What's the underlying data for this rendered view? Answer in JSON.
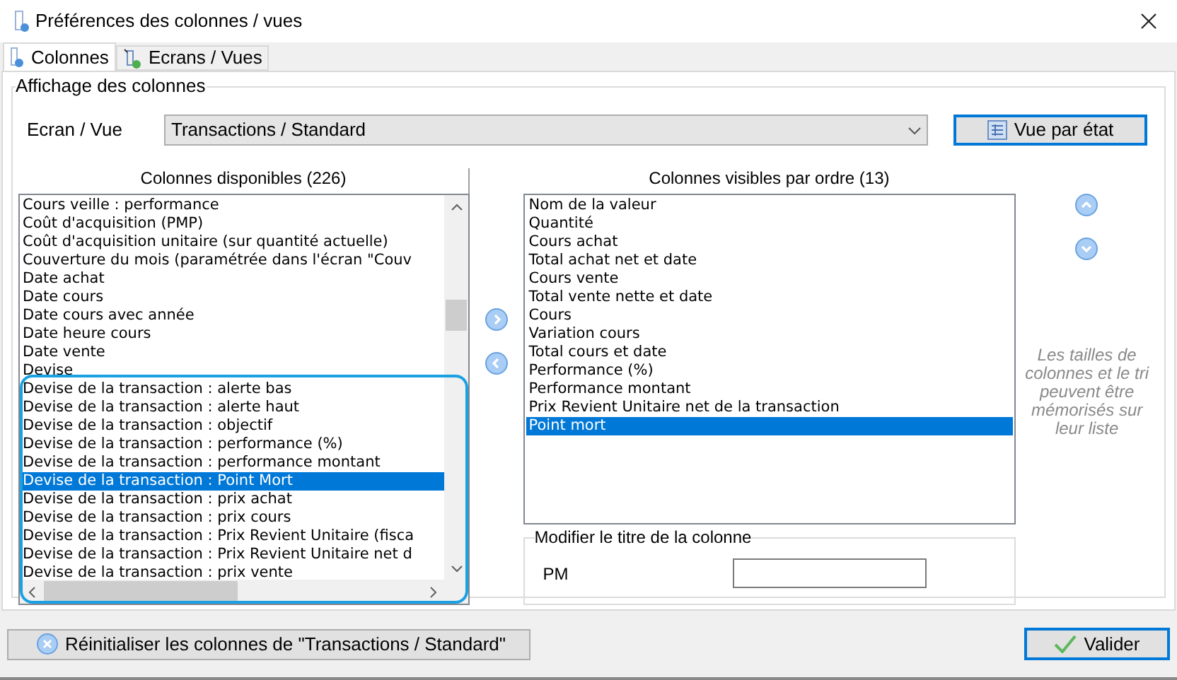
{
  "window": {
    "title": "Préférences des colonnes / vues"
  },
  "tabs": [
    {
      "label": "Colonnes",
      "selected": true
    },
    {
      "label": "Ecrans / Vues",
      "selected": false
    }
  ],
  "group_title": "Affichage des colonnes",
  "screen_view": {
    "label": "Ecran / Vue",
    "value": "Transactions / Standard"
  },
  "state_view_button": "Vue par état",
  "available": {
    "header": "Colonnes disponibles (226)",
    "items": [
      {
        "label": "Cours veille : performance",
        "selected": false
      },
      {
        "label": "Coût d'acquisition (PMP)",
        "selected": false
      },
      {
        "label": "Coût d'acquisition unitaire (sur quantité actuelle)",
        "selected": false
      },
      {
        "label": "Couverture du mois (paramétrée dans l'écran \"Couv",
        "selected": false
      },
      {
        "label": "Date achat",
        "selected": false
      },
      {
        "label": "Date cours",
        "selected": false
      },
      {
        "label": "Date cours avec année",
        "selected": false
      },
      {
        "label": "Date heure cours",
        "selected": false
      },
      {
        "label": "Date vente",
        "selected": false
      },
      {
        "label": "Devise",
        "selected": false
      },
      {
        "label": "Devise de la transaction : alerte bas",
        "selected": false
      },
      {
        "label": "Devise de la transaction : alerte haut",
        "selected": false
      },
      {
        "label": "Devise de la transaction : objectif",
        "selected": false
      },
      {
        "label": "Devise de la transaction : performance (%)",
        "selected": false
      },
      {
        "label": "Devise de la transaction : performance montant",
        "selected": false
      },
      {
        "label": "Devise de la transaction : Point Mort",
        "selected": true
      },
      {
        "label": "Devise de la transaction : prix achat",
        "selected": false
      },
      {
        "label": "Devise de la transaction : prix cours",
        "selected": false
      },
      {
        "label": "Devise de la transaction : Prix Revient Unitaire (fisca",
        "selected": false
      },
      {
        "label": "Devise de la transaction : Prix Revient Unitaire net d",
        "selected": false
      },
      {
        "label": "Devise de la transaction : prix vente",
        "selected": false
      }
    ]
  },
  "visible": {
    "header": "Colonnes visibles par ordre (13)",
    "items": [
      {
        "label": "Nom de la valeur",
        "selected": false
      },
      {
        "label": "Quantité",
        "selected": false
      },
      {
        "label": "Cours achat",
        "selected": false
      },
      {
        "label": "Total achat net et date",
        "selected": false
      },
      {
        "label": "Cours vente",
        "selected": false
      },
      {
        "label": "Total vente nette et date",
        "selected": false
      },
      {
        "label": "Cours",
        "selected": false
      },
      {
        "label": "Variation cours",
        "selected": false
      },
      {
        "label": "Total cours et date",
        "selected": false
      },
      {
        "label": "Performance (%)",
        "selected": false
      },
      {
        "label": "Performance montant",
        "selected": false
      },
      {
        "label": "Prix Revient Unitaire net de la transaction",
        "selected": false
      },
      {
        "label": "Point mort",
        "selected": true
      }
    ]
  },
  "note": "Les tailles de colonnes et le tri peuvent être mémorisés sur leur liste",
  "rename": {
    "title": "Modifier le titre de la colonne",
    "label": "PM"
  },
  "reset_button": "Réinitialiser les colonnes de \"Transactions / Standard\"",
  "validate_button": "Valider"
}
